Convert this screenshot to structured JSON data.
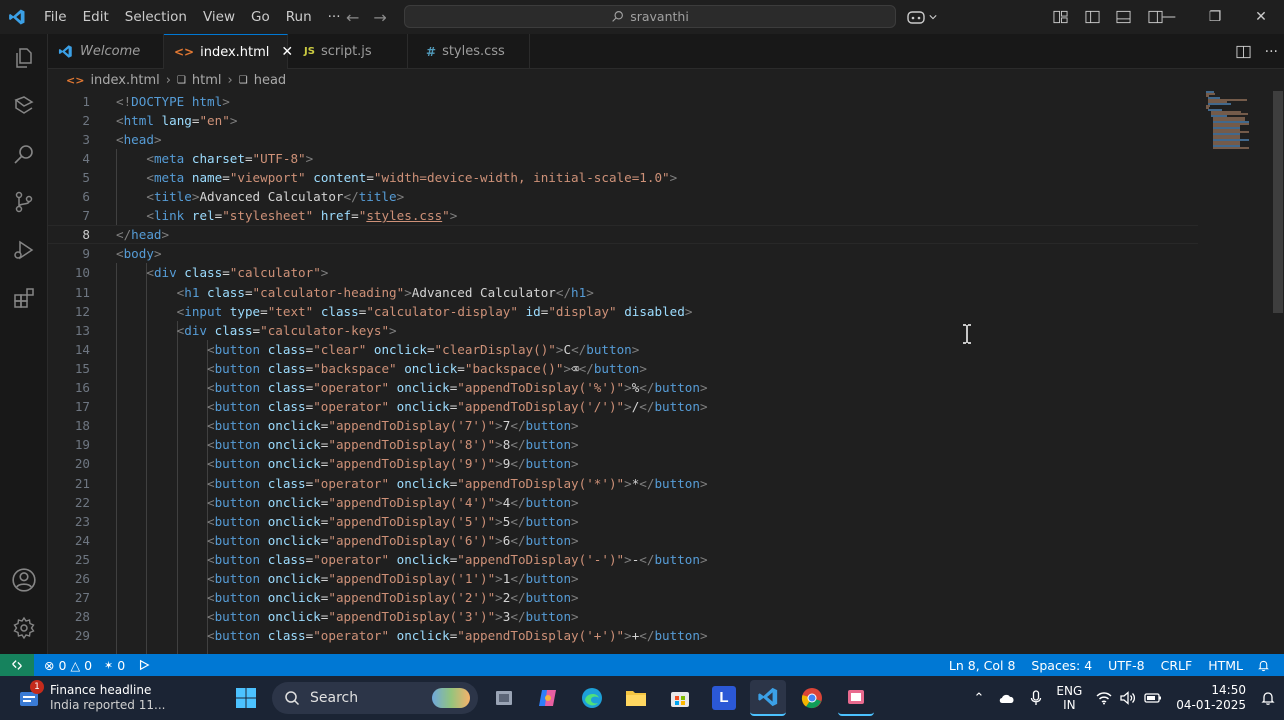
{
  "menu": [
    "File",
    "Edit",
    "Selection",
    "View",
    "Go",
    "Run",
    "···"
  ],
  "search": {
    "label": "sravanthi"
  },
  "tabs": [
    {
      "label": "Welcome",
      "icon": "vscode-icon",
      "active": false
    },
    {
      "label": "index.html",
      "icon": "html-icon",
      "active": true
    },
    {
      "label": "script.js",
      "icon": "js-icon",
      "active": false
    },
    {
      "label": "styles.css",
      "icon": "css-icon",
      "active": false
    }
  ],
  "breadcrumb": [
    "index.html",
    "html",
    "head"
  ],
  "code_lines": [
    "<!DOCTYPE html>",
    "<html lang=\"en\">",
    "<head>",
    "    <meta charset=\"UTF-8\">",
    "    <meta name=\"viewport\" content=\"width=device-width, initial-scale=1.0\">",
    "    <title>Advanced Calculator</title>",
    "    <link rel=\"stylesheet\" href=\"styles.css\">",
    "</head>",
    "<body>",
    "    <div class=\"calculator\">",
    "        <h1 class=\"calculator-heading\">Advanced Calculator</h1>",
    "        <input type=\"text\" class=\"calculator-display\" id=\"display\" disabled>",
    "        <div class=\"calculator-keys\">",
    "            <button class=\"clear\" onclick=\"clearDisplay()\">C</button>",
    "            <button class=\"backspace\" onclick=\"backspace()\">⌫</button>",
    "            <button class=\"operator\" onclick=\"appendToDisplay('%')\">%</button>",
    "            <button class=\"operator\" onclick=\"appendToDisplay('/')\">/</button>",
    "            <button onclick=\"appendToDisplay('7')\">7</button>",
    "            <button onclick=\"appendToDisplay('8')\">8</button>",
    "            <button onclick=\"appendToDisplay('9')\">9</button>",
    "            <button class=\"operator\" onclick=\"appendToDisplay('*')\">*</button>",
    "            <button onclick=\"appendToDisplay('4')\">4</button>",
    "            <button onclick=\"appendToDisplay('5')\">5</button>",
    "            <button onclick=\"appendToDisplay('6')\">6</button>",
    "            <button class=\"operator\" onclick=\"appendToDisplay('-')\">-</button>",
    "            <button onclick=\"appendToDisplay('1')\">1</button>",
    "            <button onclick=\"appendToDisplay('2')\">2</button>",
    "            <button onclick=\"appendToDisplay('3')\">3</button>",
    "            <button class=\"operator\" onclick=\"appendToDisplay('+')\">+</button>"
  ],
  "current_line": 8,
  "status": {
    "errors": "0",
    "warnings": "0",
    "ports": "0",
    "position": "Ln 8, Col 8",
    "spaces": "Spaces: 4",
    "encoding": "UTF-8",
    "eol": "CRLF",
    "language": "HTML"
  },
  "taskbar": {
    "news_title": "Finance headline",
    "news_sub": "India reported 11...",
    "news_badge": "1",
    "search": "Search",
    "lang_top": "ENG",
    "lang_bottom": "IN",
    "time": "14:50",
    "date": "04-01-2025"
  },
  "colors": {
    "accent": "#0078d4",
    "editor_bg": "#1f1f1f",
    "statusbar": "#0078d4",
    "remote": "#16825d"
  }
}
